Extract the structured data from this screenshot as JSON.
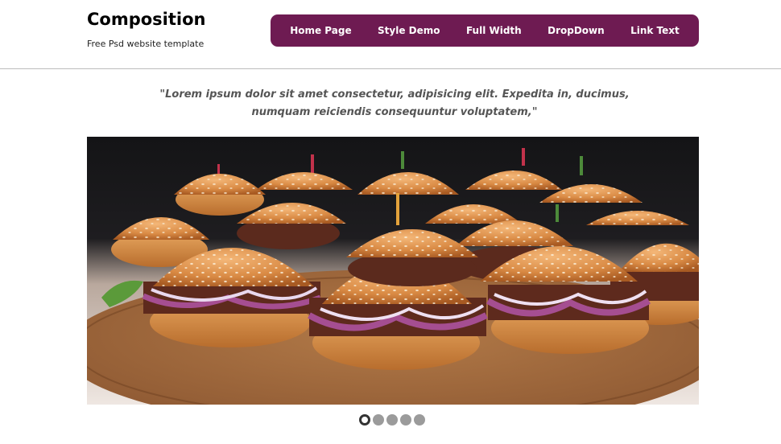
{
  "header": {
    "logo_title": "Composition",
    "logo_tagline": "Free Psd website template"
  },
  "nav": {
    "items": [
      "Home Page",
      "Style Demo",
      "Full Width",
      "DropDown",
      "Link Text"
    ],
    "background_color": "#6e1b52"
  },
  "quote": {
    "text": "\"Lorem ipsum dolor sit amet consectetur, adipisicing elit. Expedita in, ducimus, numquam reiciendis consequuntur voluptatem,\""
  },
  "slider": {
    "image_icon": "burger-sliders-photo",
    "dot_count": 5,
    "active_dot": 1
  }
}
